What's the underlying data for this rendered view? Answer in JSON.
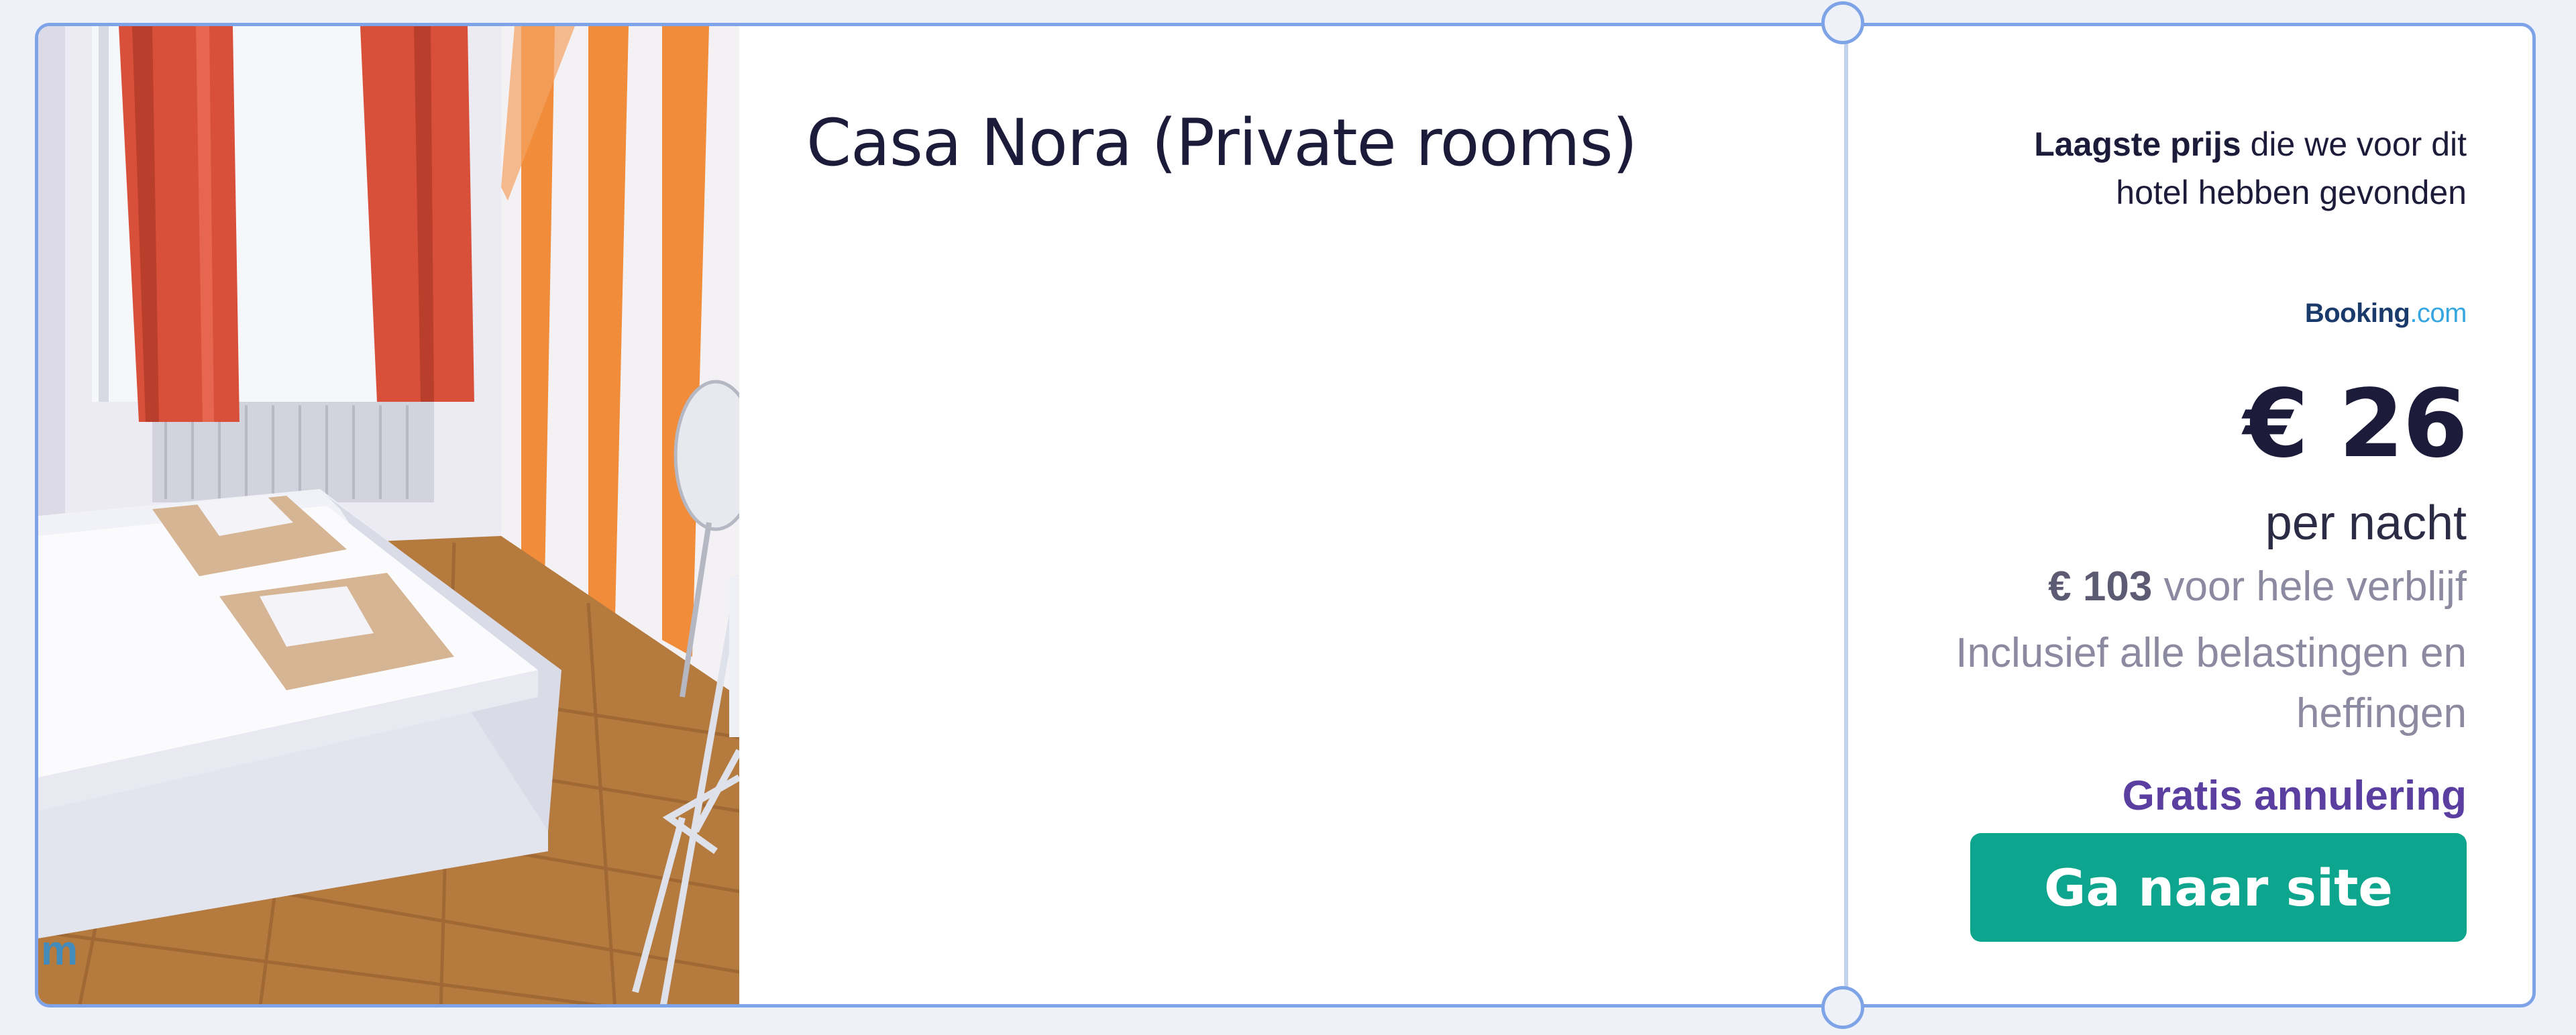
{
  "hotel": {
    "name": "Casa Nora (Private rooms)",
    "photo": {
      "description_icon": "hotel-room-photo",
      "watermark": "m"
    }
  },
  "pricing": {
    "lowest_label_bold": "Laagste prijs",
    "lowest_label_rest_1": " die we voor dit",
    "lowest_label_rest_2": "hotel hebben gevonden",
    "provider_name": "Booking",
    "provider_suffix": ".com",
    "price": "€ 26",
    "per_night": "per nacht",
    "total_amount": "€ 103",
    "total_label": " voor hele verblijf",
    "taxes_line_1": "Inclusief alle belastingen en",
    "taxes_line_2": "heffingen",
    "cancellation": "Gratis annulering",
    "cta_label": "Ga naar site"
  },
  "colors": {
    "card_border": "#7ea3e6",
    "cta_background": "#0ea58e",
    "cancellation_text": "#5a3fa1",
    "title_text": "#1d1b3a",
    "provider_brand": "#1a3a6b",
    "provider_accent": "#35a6e0"
  }
}
